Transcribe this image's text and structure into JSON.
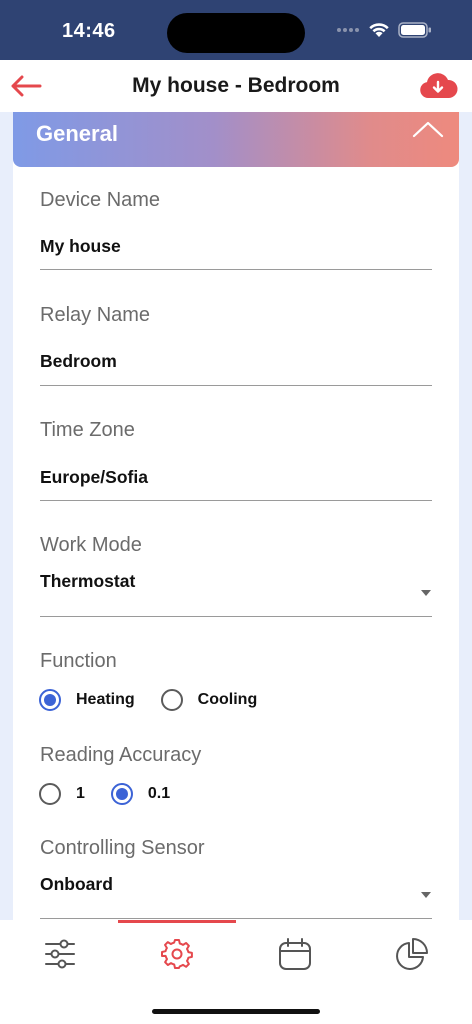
{
  "status_bar": {
    "time": "14:46"
  },
  "header": {
    "title": "My house - Bedroom"
  },
  "section": {
    "title": "General"
  },
  "fields": {
    "device_name": {
      "label": "Device Name",
      "value": "My house"
    },
    "relay_name": {
      "label": "Relay Name",
      "value": "Bedroom"
    },
    "time_zone": {
      "label": "Time Zone",
      "value": "Europe/Sofia"
    },
    "work_mode": {
      "label": "Work Mode",
      "value": "Thermostat"
    },
    "function": {
      "label": "Function",
      "options": [
        "Heating",
        "Cooling"
      ],
      "selected": "Heating"
    },
    "reading_accuracy": {
      "label": "Reading Accuracy",
      "options": [
        "1",
        "0.1"
      ],
      "selected": "0.1"
    },
    "controlling_sensor": {
      "label": "Controlling Sensor",
      "value": "Onboard"
    }
  },
  "nav": {
    "active": "settings",
    "items": [
      "sliders-icon",
      "gear-icon",
      "calendar-icon",
      "pie-chart-icon"
    ]
  },
  "colors": {
    "status_bar": "#2f4373",
    "accent_red": "#e5484d",
    "radio_blue": "#3c63d6",
    "gradient_start": "#7f9ae6",
    "gradient_end": "#ee8a7e"
  }
}
